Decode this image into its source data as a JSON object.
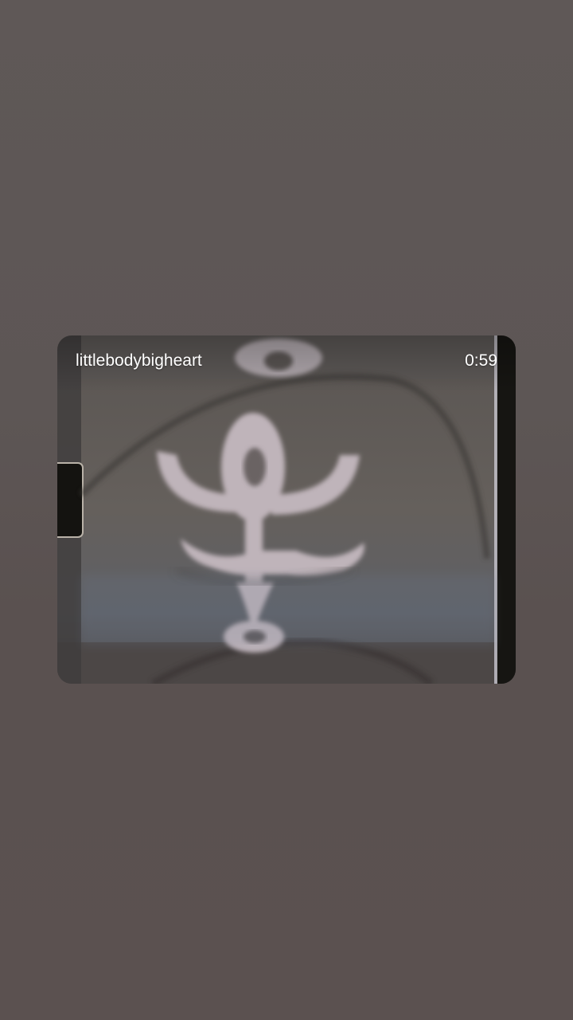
{
  "post": {
    "username": "littlebodybigheart",
    "duration": "0:59"
  },
  "colors": {
    "background": "#5d5655",
    "overlay_text": "#ffffff"
  },
  "media": {
    "description_icon": "film-strip-ornament"
  }
}
